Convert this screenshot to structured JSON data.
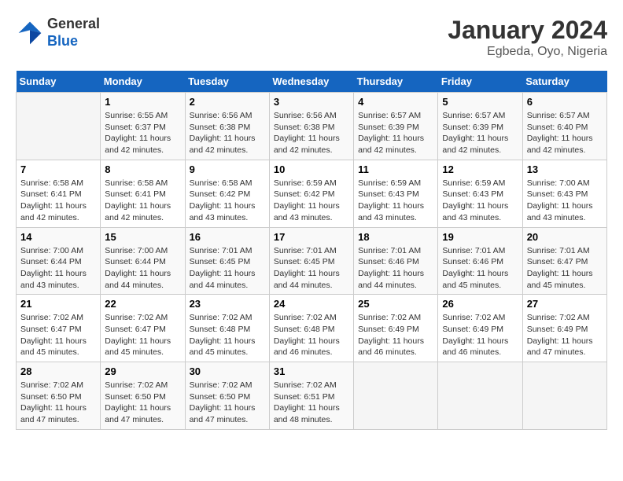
{
  "logo": {
    "general": "General",
    "blue": "Blue"
  },
  "header": {
    "title": "January 2024",
    "subtitle": "Egbeda, Oyo, Nigeria"
  },
  "days_of_week": [
    "Sunday",
    "Monday",
    "Tuesday",
    "Wednesday",
    "Thursday",
    "Friday",
    "Saturday"
  ],
  "weeks": [
    [
      {
        "day": "",
        "info": ""
      },
      {
        "day": "1",
        "info": "Sunrise: 6:55 AM\nSunset: 6:37 PM\nDaylight: 11 hours\nand 42 minutes."
      },
      {
        "day": "2",
        "info": "Sunrise: 6:56 AM\nSunset: 6:38 PM\nDaylight: 11 hours\nand 42 minutes."
      },
      {
        "day": "3",
        "info": "Sunrise: 6:56 AM\nSunset: 6:38 PM\nDaylight: 11 hours\nand 42 minutes."
      },
      {
        "day": "4",
        "info": "Sunrise: 6:57 AM\nSunset: 6:39 PM\nDaylight: 11 hours\nand 42 minutes."
      },
      {
        "day": "5",
        "info": "Sunrise: 6:57 AM\nSunset: 6:39 PM\nDaylight: 11 hours\nand 42 minutes."
      },
      {
        "day": "6",
        "info": "Sunrise: 6:57 AM\nSunset: 6:40 PM\nDaylight: 11 hours\nand 42 minutes."
      }
    ],
    [
      {
        "day": "7",
        "info": "Sunrise: 6:58 AM\nSunset: 6:41 PM\nDaylight: 11 hours\nand 42 minutes."
      },
      {
        "day": "8",
        "info": "Sunrise: 6:58 AM\nSunset: 6:41 PM\nDaylight: 11 hours\nand 42 minutes."
      },
      {
        "day": "9",
        "info": "Sunrise: 6:58 AM\nSunset: 6:42 PM\nDaylight: 11 hours\nand 43 minutes."
      },
      {
        "day": "10",
        "info": "Sunrise: 6:59 AM\nSunset: 6:42 PM\nDaylight: 11 hours\nand 43 minutes."
      },
      {
        "day": "11",
        "info": "Sunrise: 6:59 AM\nSunset: 6:43 PM\nDaylight: 11 hours\nand 43 minutes."
      },
      {
        "day": "12",
        "info": "Sunrise: 6:59 AM\nSunset: 6:43 PM\nDaylight: 11 hours\nand 43 minutes."
      },
      {
        "day": "13",
        "info": "Sunrise: 7:00 AM\nSunset: 6:43 PM\nDaylight: 11 hours\nand 43 minutes."
      }
    ],
    [
      {
        "day": "14",
        "info": "Sunrise: 7:00 AM\nSunset: 6:44 PM\nDaylight: 11 hours\nand 43 minutes."
      },
      {
        "day": "15",
        "info": "Sunrise: 7:00 AM\nSunset: 6:44 PM\nDaylight: 11 hours\nand 44 minutes."
      },
      {
        "day": "16",
        "info": "Sunrise: 7:01 AM\nSunset: 6:45 PM\nDaylight: 11 hours\nand 44 minutes."
      },
      {
        "day": "17",
        "info": "Sunrise: 7:01 AM\nSunset: 6:45 PM\nDaylight: 11 hours\nand 44 minutes."
      },
      {
        "day": "18",
        "info": "Sunrise: 7:01 AM\nSunset: 6:46 PM\nDaylight: 11 hours\nand 44 minutes."
      },
      {
        "day": "19",
        "info": "Sunrise: 7:01 AM\nSunset: 6:46 PM\nDaylight: 11 hours\nand 45 minutes."
      },
      {
        "day": "20",
        "info": "Sunrise: 7:01 AM\nSunset: 6:47 PM\nDaylight: 11 hours\nand 45 minutes."
      }
    ],
    [
      {
        "day": "21",
        "info": "Sunrise: 7:02 AM\nSunset: 6:47 PM\nDaylight: 11 hours\nand 45 minutes."
      },
      {
        "day": "22",
        "info": "Sunrise: 7:02 AM\nSunset: 6:47 PM\nDaylight: 11 hours\nand 45 minutes."
      },
      {
        "day": "23",
        "info": "Sunrise: 7:02 AM\nSunset: 6:48 PM\nDaylight: 11 hours\nand 45 minutes."
      },
      {
        "day": "24",
        "info": "Sunrise: 7:02 AM\nSunset: 6:48 PM\nDaylight: 11 hours\nand 46 minutes."
      },
      {
        "day": "25",
        "info": "Sunrise: 7:02 AM\nSunset: 6:49 PM\nDaylight: 11 hours\nand 46 minutes."
      },
      {
        "day": "26",
        "info": "Sunrise: 7:02 AM\nSunset: 6:49 PM\nDaylight: 11 hours\nand 46 minutes."
      },
      {
        "day": "27",
        "info": "Sunrise: 7:02 AM\nSunset: 6:49 PM\nDaylight: 11 hours\nand 47 minutes."
      }
    ],
    [
      {
        "day": "28",
        "info": "Sunrise: 7:02 AM\nSunset: 6:50 PM\nDaylight: 11 hours\nand 47 minutes."
      },
      {
        "day": "29",
        "info": "Sunrise: 7:02 AM\nSunset: 6:50 PM\nDaylight: 11 hours\nand 47 minutes."
      },
      {
        "day": "30",
        "info": "Sunrise: 7:02 AM\nSunset: 6:50 PM\nDaylight: 11 hours\nand 47 minutes."
      },
      {
        "day": "31",
        "info": "Sunrise: 7:02 AM\nSunset: 6:51 PM\nDaylight: 11 hours\nand 48 minutes."
      },
      {
        "day": "",
        "info": ""
      },
      {
        "day": "",
        "info": ""
      },
      {
        "day": "",
        "info": ""
      }
    ]
  ]
}
